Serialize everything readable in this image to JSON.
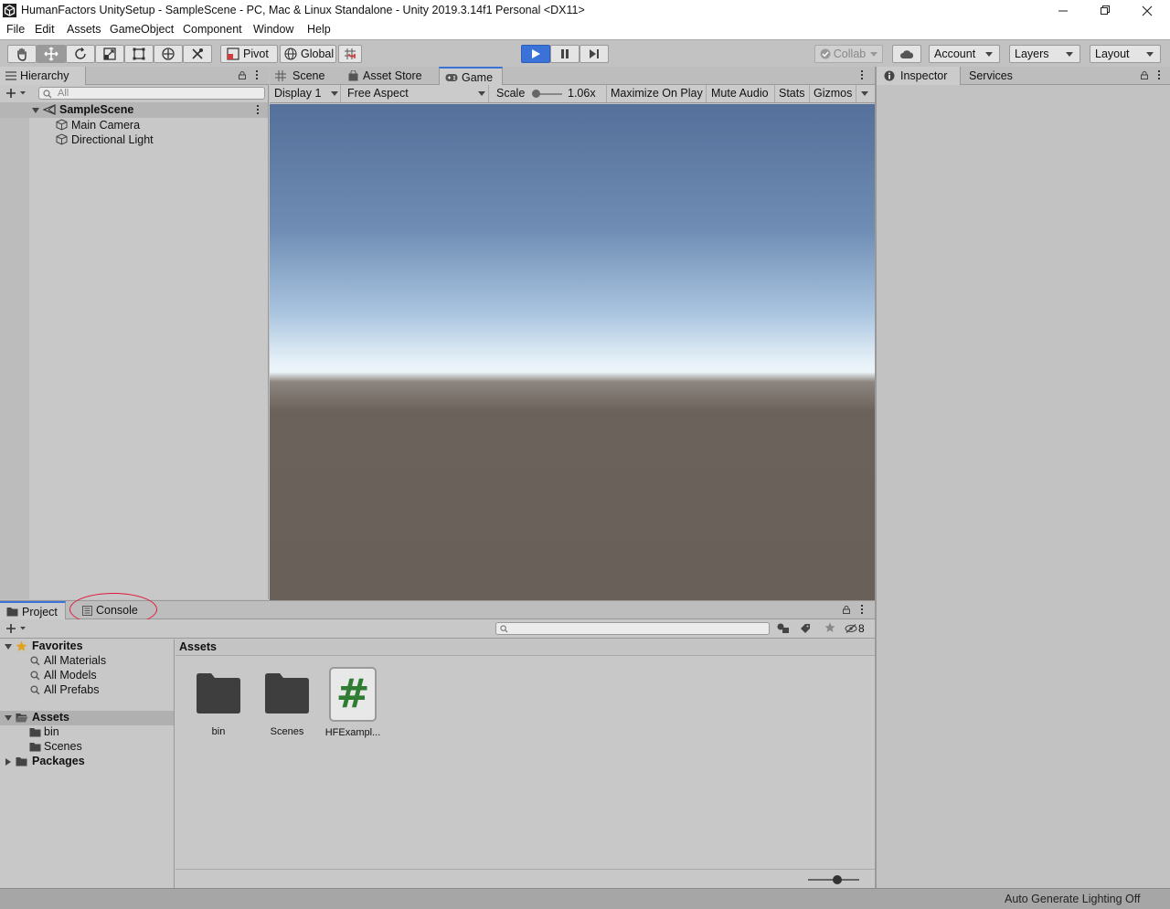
{
  "window": {
    "title": "HumanFactors UnitySetup - SampleScene - PC, Mac & Linux Standalone - Unity 2019.3.14f1 Personal <DX11>"
  },
  "menu": [
    "File",
    "Edit",
    "Assets",
    "GameObject",
    "Component",
    "Window",
    "Help"
  ],
  "toolbar": {
    "pivot": "Pivot",
    "global": "Global",
    "collab": "Collab",
    "account": "Account",
    "layers": "Layers",
    "layout": "Layout"
  },
  "hierarchy": {
    "tab": "Hierarchy",
    "search_placeholder": "All",
    "scene": "SampleScene",
    "objects": [
      "Main Camera",
      "Directional Light"
    ]
  },
  "center": {
    "tabs": [
      "Scene",
      "Asset Store",
      "Game"
    ],
    "active_tab": "Game",
    "display": "Display 1",
    "aspect": "Free Aspect",
    "scale_label": "Scale",
    "scale_value": "1.06x",
    "maximize": "Maximize On Play",
    "mute": "Mute Audio",
    "stats": "Stats",
    "gizmos": "Gizmos"
  },
  "inspector": {
    "tabs": [
      "Inspector",
      "Services"
    ]
  },
  "bottom": {
    "tabs": [
      "Project",
      "Console"
    ],
    "hidden_count": "8",
    "favorites": {
      "label": "Favorites",
      "items": [
        "All Materials",
        "All Models",
        "All Prefabs"
      ]
    },
    "assets_tree": {
      "label": "Assets",
      "children": [
        "bin",
        "Scenes"
      ]
    },
    "packages": "Packages",
    "breadcrumb": "Assets",
    "assets": [
      {
        "name": "bin",
        "type": "folder"
      },
      {
        "name": "Scenes",
        "type": "folder"
      },
      {
        "name": "HFExampl...",
        "type": "script",
        "glyph": "#"
      }
    ]
  },
  "statusbar": {
    "text": "Auto Generate Lighting Off"
  },
  "colors": {
    "play_active": "#3a72d8",
    "annotation_circle": "#e0193a",
    "script_hash": "#2e7d32"
  }
}
